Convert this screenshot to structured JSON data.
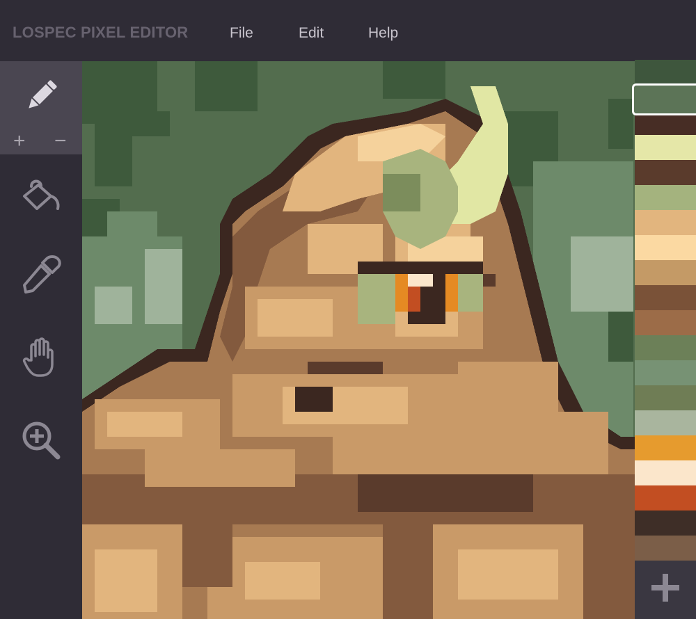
{
  "app": {
    "title": "LOSPEC PIXEL EDITOR"
  },
  "menu": [
    {
      "label": "File"
    },
    {
      "label": "Edit"
    },
    {
      "label": "Help"
    }
  ],
  "tools": {
    "selected": "pencil",
    "size_increase_label": "+",
    "size_decrease_label": "−",
    "items": [
      {
        "icon": "pencil-icon"
      },
      {
        "icon": "fill-bucket-icon"
      },
      {
        "icon": "eyedropper-icon"
      },
      {
        "icon": "hand-pan-icon"
      },
      {
        "icon": "zoom-in-icon"
      }
    ]
  },
  "palette": {
    "selected_index": 1,
    "colors": [
      "#3e563d",
      "#5c7457",
      "#472d25",
      "#e5e7a8",
      "#5a3b2c",
      "#a4b37e",
      "#e2b57e",
      "#fbd9a2",
      "#c49a66",
      "#7a5238",
      "#9c6c48",
      "#6c8058",
      "#779274",
      "#6f7d55",
      "#a9b59e",
      "#e69b2e",
      "#fbe6cb",
      "#c24e22",
      "#3e2e27",
      "#7b5e48"
    ],
    "add_icon": "plus-icon"
  },
  "canvas": {
    "colors": {
      "bg_dark": "#3e5a3c",
      "bg_mid": "#536d4e",
      "bg_light": "#6d8a6a",
      "bg_pale": "#9fb39b",
      "outline": "#3b2720",
      "skin_dark": "#5a3b2c",
      "skin_mid": "#835a3e",
      "skin": "#a77a52",
      "skin_light": "#c99a68",
      "skin_highlight": "#e2b57e",
      "skin_top": "#f5d29c",
      "horn_light": "#e1e7a4",
      "horn_mid": "#a8b47e",
      "horn_dark": "#7c8d5c",
      "eye_orange": "#e58a23",
      "eye_red": "#c24e22",
      "eye_white": "#fbe6cb"
    }
  }
}
